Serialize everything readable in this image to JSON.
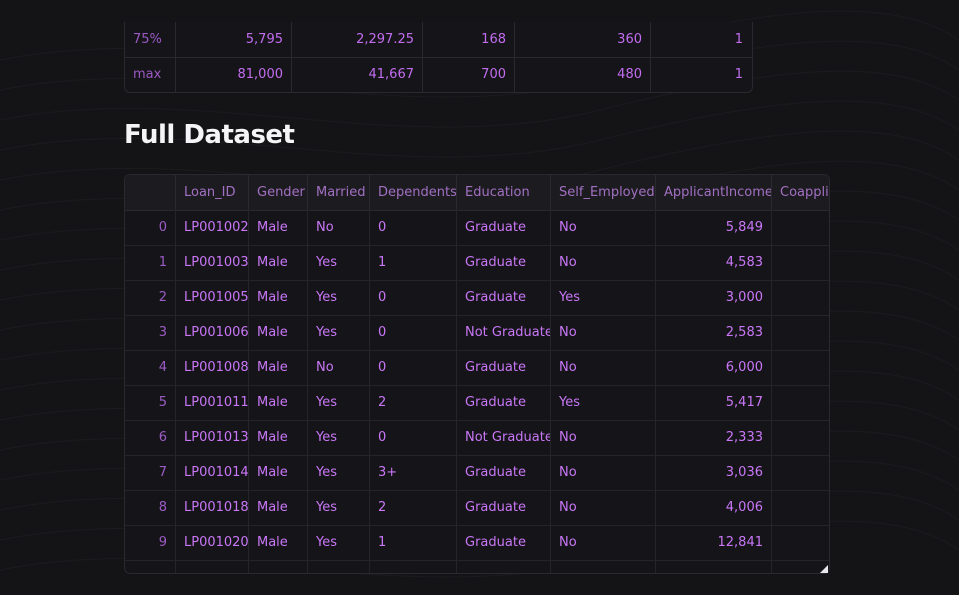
{
  "summary": {
    "rows": [
      {
        "index": "75%",
        "values": [
          "5,795",
          "2,297.25",
          "168",
          "360",
          "1"
        ]
      },
      {
        "index": "max",
        "values": [
          "81,000",
          "41,667",
          "700",
          "480",
          "1"
        ]
      }
    ]
  },
  "section_title": "Full Dataset",
  "dataset": {
    "columns": [
      "",
      "Loan_ID",
      "Gender",
      "Married",
      "Dependents",
      "Education",
      "Self_Employed",
      "ApplicantIncome",
      "Coapplic"
    ],
    "rows": [
      {
        "index": "0",
        "loan_id": "LP001002",
        "gender": "Male",
        "married": "No",
        "dependents": "0",
        "education": "Graduate",
        "self_employed": "No",
        "applicant_income": "5,849"
      },
      {
        "index": "1",
        "loan_id": "LP001003",
        "gender": "Male",
        "married": "Yes",
        "dependents": "1",
        "education": "Graduate",
        "self_employed": "No",
        "applicant_income": "4,583"
      },
      {
        "index": "2",
        "loan_id": "LP001005",
        "gender": "Male",
        "married": "Yes",
        "dependents": "0",
        "education": "Graduate",
        "self_employed": "Yes",
        "applicant_income": "3,000"
      },
      {
        "index": "3",
        "loan_id": "LP001006",
        "gender": "Male",
        "married": "Yes",
        "dependents": "0",
        "education": "Not Graduate",
        "self_employed": "No",
        "applicant_income": "2,583"
      },
      {
        "index": "4",
        "loan_id": "LP001008",
        "gender": "Male",
        "married": "No",
        "dependents": "0",
        "education": "Graduate",
        "self_employed": "No",
        "applicant_income": "6,000"
      },
      {
        "index": "5",
        "loan_id": "LP001011",
        "gender": "Male",
        "married": "Yes",
        "dependents": "2",
        "education": "Graduate",
        "self_employed": "Yes",
        "applicant_income": "5,417"
      },
      {
        "index": "6",
        "loan_id": "LP001013",
        "gender": "Male",
        "married": "Yes",
        "dependents": "0",
        "education": "Not Graduate",
        "self_employed": "No",
        "applicant_income": "2,333"
      },
      {
        "index": "7",
        "loan_id": "LP001014",
        "gender": "Male",
        "married": "Yes",
        "dependents": "3+",
        "education": "Graduate",
        "self_employed": "No",
        "applicant_income": "3,036"
      },
      {
        "index": "8",
        "loan_id": "LP001018",
        "gender": "Male",
        "married": "Yes",
        "dependents": "2",
        "education": "Graduate",
        "self_employed": "No",
        "applicant_income": "4,006"
      },
      {
        "index": "9",
        "loan_id": "LP001020",
        "gender": "Male",
        "married": "Yes",
        "dependents": "1",
        "education": "Graduate",
        "self_employed": "No",
        "applicant_income": "12,841"
      }
    ]
  },
  "colors": {
    "background": "#141316",
    "accent_text": "#c977f7",
    "header_text": "#a270c2",
    "title_text": "#f5f5f7",
    "border": "#2a2830"
  }
}
